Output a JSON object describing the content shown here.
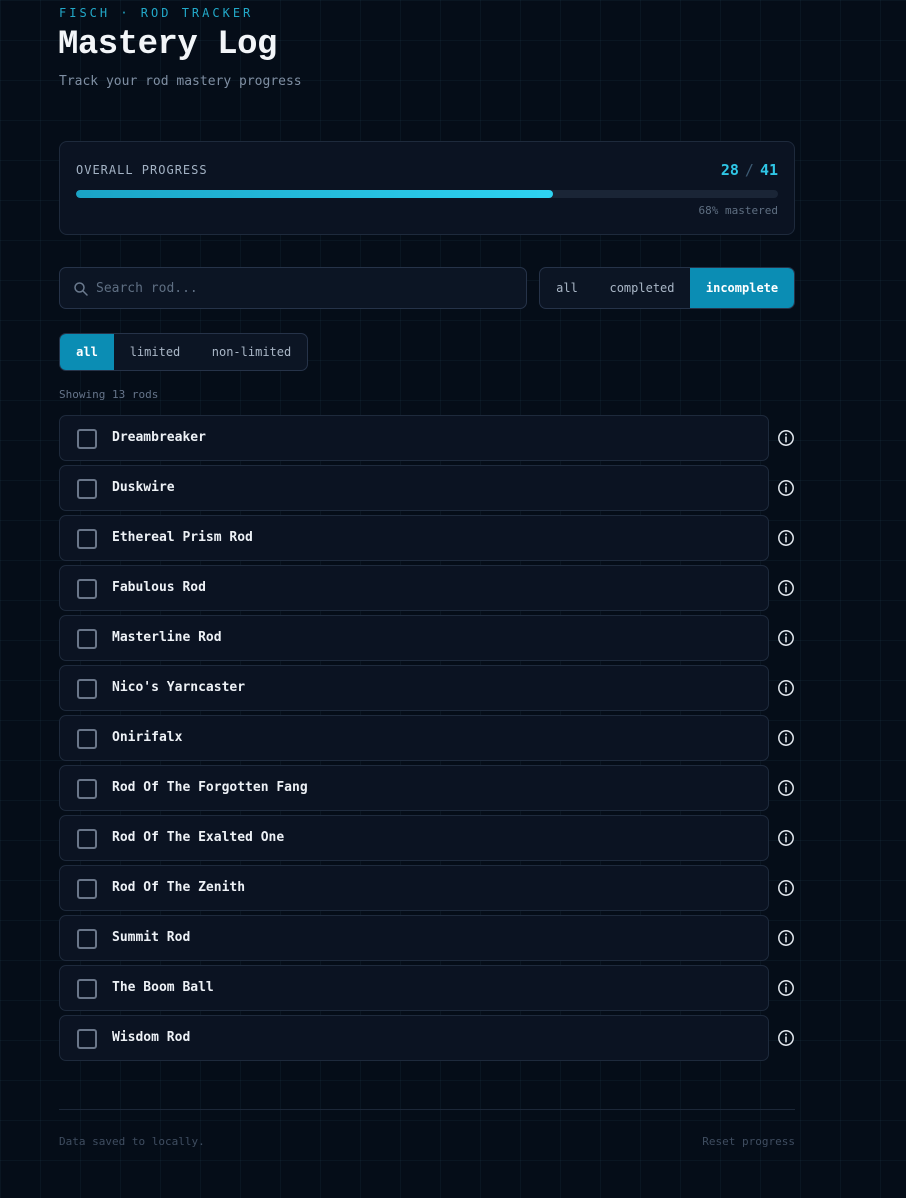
{
  "header": {
    "eyebrow": "FISCH · ROD TRACKER",
    "title": "Mastery Log",
    "subtitle": "Track your rod mastery progress"
  },
  "progress": {
    "label": "OVERALL PROGRESS",
    "done": "28",
    "separator": "/",
    "total": "41",
    "fraction": 0.68,
    "percent_text": "68% mastered"
  },
  "search": {
    "placeholder": "Search rod..."
  },
  "status_filter": {
    "options": [
      "all",
      "completed",
      "incomplete"
    ],
    "selected": "incomplete"
  },
  "type_filter": {
    "options": [
      "all",
      "limited",
      "non-limited"
    ],
    "selected": "all"
  },
  "showing_text": "Showing 13 rods",
  "rods": [
    {
      "name": "Dreambreaker",
      "completed": false
    },
    {
      "name": "Duskwire",
      "completed": false
    },
    {
      "name": "Ethereal Prism Rod",
      "completed": false
    },
    {
      "name": "Fabulous Rod",
      "completed": false
    },
    {
      "name": "Masterline Rod",
      "completed": false
    },
    {
      "name": "Nico's Yarncaster",
      "completed": false
    },
    {
      "name": "Onirifalx",
      "completed": false
    },
    {
      "name": "Rod Of The Forgotten Fang",
      "completed": false
    },
    {
      "name": "Rod Of The Exalted One",
      "completed": false
    },
    {
      "name": "Rod Of The Zenith",
      "completed": false
    },
    {
      "name": "Summit Rod",
      "completed": false
    },
    {
      "name": "The Boom Ball",
      "completed": false
    },
    {
      "name": "Wisdom Rod",
      "completed": false
    }
  ],
  "footer": {
    "note": "Data saved to locally.",
    "reset_label": "Reset progress"
  },
  "colors": {
    "accent": "#0b8db4",
    "progress_fill": "#2ed3f2",
    "background": "#050d18",
    "card": "#0b1322"
  }
}
